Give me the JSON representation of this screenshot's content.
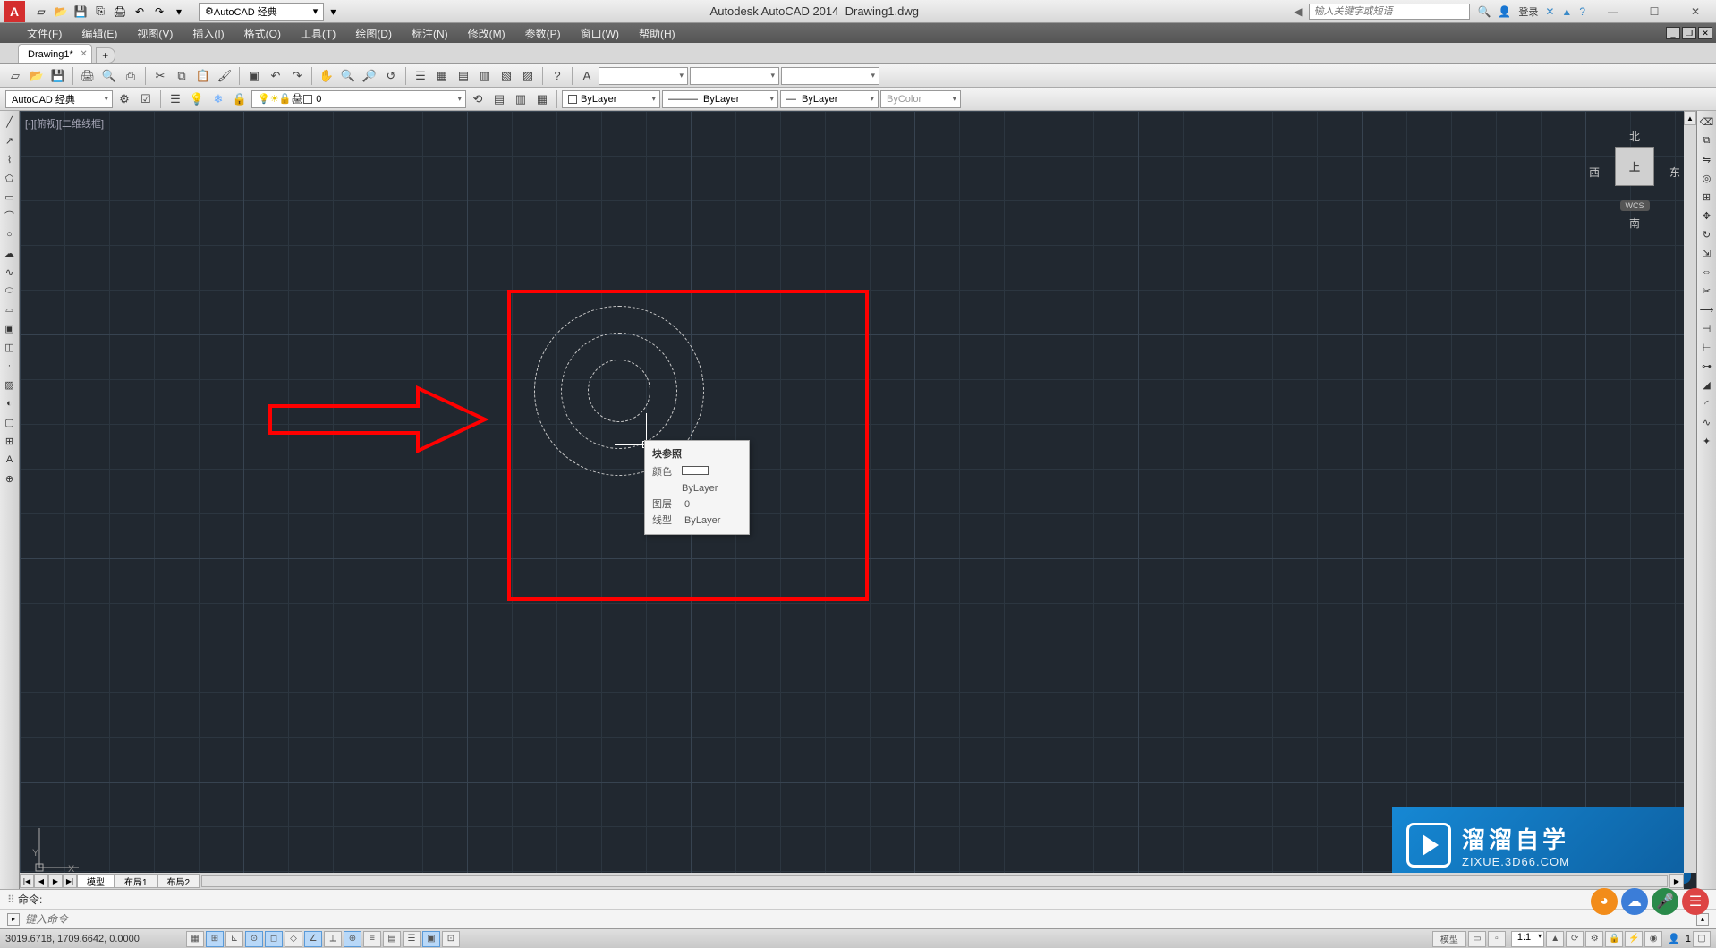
{
  "title": {
    "app": "Autodesk AutoCAD 2014",
    "doc": "Drawing1.dwg"
  },
  "search_placeholder": "输入关键字或短语",
  "signin": "登录",
  "workspace": "AutoCAD 经典",
  "menus": [
    "文件(F)",
    "编辑(E)",
    "视图(V)",
    "插入(I)",
    "格式(O)",
    "工具(T)",
    "绘图(D)",
    "标注(N)",
    "修改(M)",
    "参数(P)",
    "窗口(W)",
    "帮助(H)"
  ],
  "doc_tab": "Drawing1*",
  "props": {
    "workspace_dd": "AutoCAD 经典",
    "layer_dd": "0",
    "color_dd": "ByLayer",
    "linetype_dd": "ByLayer",
    "lineweight_dd": "ByLayer",
    "plotstyle": "ByColor"
  },
  "viewport_label": "[-][俯视][二维线框]",
  "tooltip": {
    "title": "块参照",
    "color_k": "颜色",
    "color_v": "ByLayer",
    "layer_k": "图层",
    "layer_v": "0",
    "ltype_k": "线型",
    "ltype_v": "ByLayer"
  },
  "viewcube": {
    "top": "上",
    "n": "北",
    "s": "南",
    "w": "西",
    "e": "东",
    "wcs": "WCS"
  },
  "layout_tabs": {
    "model": "模型",
    "l1": "布局1",
    "l2": "布局2"
  },
  "cmd_label": "命令:",
  "cmd_placeholder": "键入命令",
  "coords": "3019.6718, 1709.6642, 0.0000",
  "status_right": {
    "model": "模型",
    "annoscale": "1:1",
    "peoplecount": "1"
  },
  "watermark": {
    "big": "溜溜自学",
    "sub": "ZIXUE.3D66.COM"
  },
  "axes": {
    "x": "X",
    "y": "Y"
  }
}
